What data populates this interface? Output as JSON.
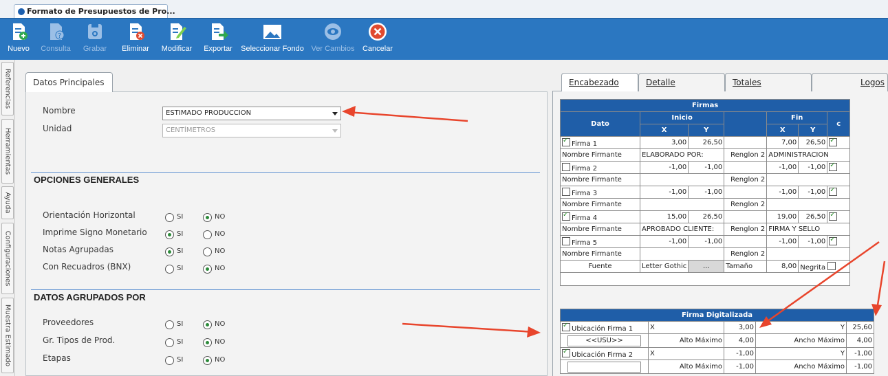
{
  "window": {
    "title": "Formato de Presupuestos de Pro..."
  },
  "toolbar": {
    "buttons": [
      {
        "label": "Nuevo",
        "icon": "new-document-icon",
        "enabled": true
      },
      {
        "label": "Consulta",
        "icon": "query-document-icon",
        "enabled": false
      },
      {
        "label": "Grabar",
        "icon": "save-icon",
        "enabled": false
      },
      {
        "label": "Eliminar",
        "icon": "delete-document-icon",
        "enabled": true
      },
      {
        "label": "Modificar",
        "icon": "edit-document-icon",
        "enabled": true
      },
      {
        "label": "Exportar",
        "icon": "export-icon",
        "enabled": true
      },
      {
        "label": "Seleccionar Fondo",
        "icon": "image-icon",
        "enabled": true
      },
      {
        "label": "Ver Cambios",
        "icon": "view-changes-icon",
        "enabled": false
      },
      {
        "label": "Cancelar",
        "icon": "cancel-icon",
        "enabled": true
      }
    ]
  },
  "side_tabs": [
    "Referencias",
    "Herramientas",
    "Ayuda",
    "Configuraciones",
    "Muestra Estimado"
  ],
  "left": {
    "tab": "Datos Principales",
    "nombre_label": "Nombre",
    "nombre_value": "ESTIMADO PRODUCCION",
    "unidad_label": "Unidad",
    "unidad_value": "CENTÍMETROS",
    "opciones_title": "OPCIONES GENERALES",
    "opciones": [
      {
        "label": "Orientación Horizontal",
        "value": "NO"
      },
      {
        "label": "Imprime Signo Monetario",
        "value": "SI"
      },
      {
        "label": "Notas Agrupadas",
        "value": "SI"
      },
      {
        "label": "Con Recuadros (BNX)",
        "value": "NO"
      }
    ],
    "agrupados_title": "DATOS AGRUPADOS POR",
    "agrupados": [
      {
        "label": "Proveedores",
        "value": "NO"
      },
      {
        "label": "Gr. Tipos de Prod.",
        "value": "NO"
      },
      {
        "label": "Etapas",
        "value": "NO"
      }
    ],
    "si_label": "SI",
    "no_label": "NO"
  },
  "right": {
    "tabs": [
      "Encabezado",
      "Detalle",
      "Totales",
      "Logos"
    ],
    "firmas": {
      "title": "Firmas",
      "h_dato": "Dato",
      "h_inicio": "Inicio",
      "h_fin": "Fin",
      "h_x": "X",
      "h_y": "Y",
      "h_c": "c",
      "rows": [
        {
          "name": "Firma 1",
          "checked": true,
          "x1": "3,00",
          "y1": "26,50",
          "x2": "7,00",
          "y2": "26,50",
          "c": true,
          "nf": "Nombre Firmante",
          "nf_value": "ELABORADO POR:",
          "r2": "Renglon 2",
          "r2_value": "ADMINISTRACION"
        },
        {
          "name": "Firma 2",
          "checked": false,
          "x1": "-1,00",
          "y1": "-1,00",
          "x2": "-1,00",
          "y2": "-1,00",
          "c": true,
          "nf": "Nombre Firmante",
          "nf_value": "",
          "r2": "Renglon 2",
          "r2_value": ""
        },
        {
          "name": "Firma 3",
          "checked": false,
          "x1": "-1,00",
          "y1": "-1,00",
          "x2": "-1,00",
          "y2": "-1,00",
          "c": true,
          "nf": "Nombre Firmante",
          "nf_value": "",
          "r2": "Renglon 2",
          "r2_value": ""
        },
        {
          "name": "Firma 4",
          "checked": true,
          "x1": "15,00",
          "y1": "26,50",
          "x2": "19,00",
          "y2": "26,50",
          "c": true,
          "nf": "Nombre Firmante",
          "nf_value": "APROBADO CLIENTE:",
          "r2": "Renglon 2",
          "r2_value": "FIRMA Y SELLO"
        },
        {
          "name": "Firma 5",
          "checked": false,
          "x1": "-1,00",
          "y1": "-1,00",
          "x2": "-1,00",
          "y2": "-1,00",
          "c": true,
          "nf": "Nombre Firmante",
          "nf_value": "",
          "r2": "Renglon 2",
          "r2_value": ""
        }
      ],
      "fuente_label": "Fuente",
      "fuente_value": "Letter Gothic",
      "fuente_btn": "...",
      "tamano_label": "Tamaño",
      "tamano_value": "8,00",
      "negrita_label": "Negrita"
    },
    "firma_digitalizada": {
      "title": "Firma Digitalizada",
      "rows": [
        {
          "name": "Ubicación Firma 1",
          "checked": true,
          "x_label": "X",
          "x": "3,00",
          "y_label": "Y",
          "y": "25,60",
          "sub": "<<USU>>",
          "alto_label": "Alto Máximo",
          "alto": "4,00",
          "ancho_label": "Ancho Máximo",
          "ancho": "4,00"
        },
        {
          "name": "Ubicación Firma 2",
          "checked": true,
          "x_label": "X",
          "x": "-1,00",
          "y_label": "Y",
          "y": "-1,00",
          "sub": "",
          "alto_label": "Alto Máximo",
          "alto": "-1,00",
          "ancho_label": "Ancho Máximo",
          "ancho": "-1,00"
        }
      ]
    }
  },
  "colors": {
    "toolbar": "#2b77c1",
    "table_header": "#1f5ea8",
    "annotation_arrow": "#e8452c"
  }
}
